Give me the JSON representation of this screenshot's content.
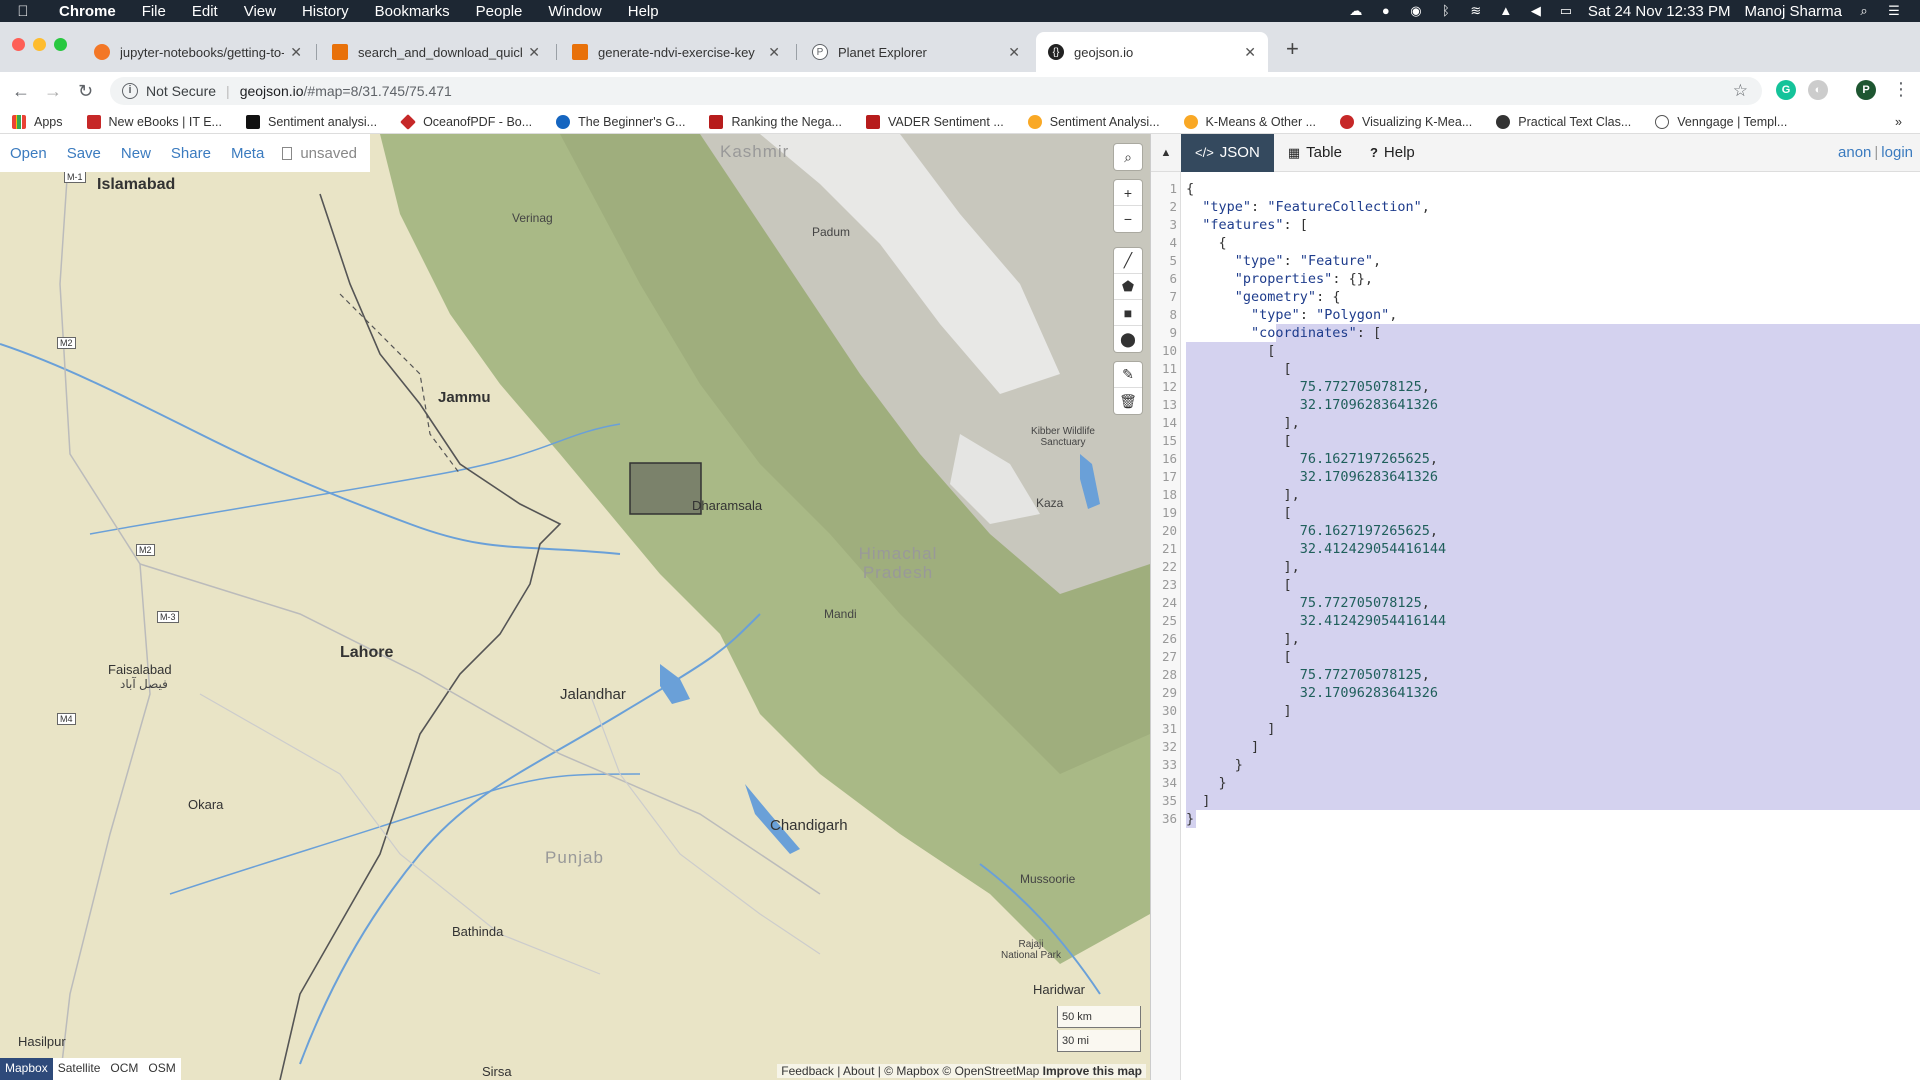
{
  "menubar": {
    "app": "Chrome",
    "items": [
      "File",
      "Edit",
      "View",
      "History",
      "Bookmarks",
      "People",
      "Window",
      "Help"
    ],
    "datetime": "Sat 24 Nov  12:33 PM",
    "user": "Manoj Sharma"
  },
  "tabs": [
    {
      "label": "jupyter-notebooks/getting-to-",
      "color": "#f37726"
    },
    {
      "label": "search_and_download_quickst",
      "color": "#e8710a"
    },
    {
      "label": "generate-ndvi-exercise-key",
      "color": "#e8710a"
    },
    {
      "label": "Planet Explorer",
      "color": "#5f6368"
    },
    {
      "label": "geojson.io",
      "color": "#222222"
    }
  ],
  "address": {
    "security": "Not Secure",
    "host": "geojson.io",
    "path": "/#map=8/31.745/75.471"
  },
  "bookmarks": [
    {
      "label": "Apps",
      "color": "#4285f4"
    },
    {
      "label": "New eBooks | IT E...",
      "color": "#c62828"
    },
    {
      "label": "Sentiment analysi...",
      "color": "#111111"
    },
    {
      "label": "OceanofPDF - Bo...",
      "color": "#c62828"
    },
    {
      "label": "The Beginner's G...",
      "color": "#1565c0"
    },
    {
      "label": "Ranking the Nega...",
      "color": "#b71c1c"
    },
    {
      "label": "VADER Sentiment ...",
      "color": "#b71c1c"
    },
    {
      "label": "Sentiment Analysi...",
      "color": "#f9a825"
    },
    {
      "label": "K-Means & Other ...",
      "color": "#f9a825"
    },
    {
      "label": "Visualizing K-Mea...",
      "color": "#c62828"
    },
    {
      "label": "Practical Text Clas...",
      "color": "#333333"
    },
    {
      "label": "Venngage | Templ...",
      "color": "#555555"
    }
  ],
  "map_toolbar": {
    "open": "Open",
    "save": "Save",
    "new": "New",
    "share": "Share",
    "meta": "Meta",
    "status": "unsaved"
  },
  "map_labels": {
    "kashmir": "Kashmir",
    "islamabad": "Islamabad",
    "verinag": "Verinag",
    "padum": "Padum",
    "jammu": "Jammu",
    "kibber": "Kibber Wildlife Sanctuary",
    "dharamsala": "Dharamsala",
    "kaza": "Kaza",
    "himachal": "Himachal Pradesh",
    "mandi": "Mandi",
    "lahore": "Lahore",
    "faisalabad": "Faisalabad",
    "faisalabad_ur": "فیصل آباد",
    "jalandhar": "Jalandhar",
    "okara": "Okara",
    "chandigarh": "Chandigarh",
    "punjab": "Punjab",
    "mussoorie": "Mussoorie",
    "bathinda": "Bathinda",
    "rajaji": "Rajaji National Park",
    "haridwar": "Haridwar",
    "hasilpur": "Hasilpur",
    "sirsa": "Sirsa",
    "m1": "M-1",
    "m2a": "M2",
    "m2b": "M2",
    "m3": "M-3",
    "m4": "M4"
  },
  "scale": {
    "km": "50 km",
    "mi": "30 mi"
  },
  "layers": [
    "Mapbox",
    "Satellite",
    "OCM",
    "OSM"
  ],
  "attribution": {
    "text": "Feedback | About | © Mapbox © OpenStreetMap",
    "improve": "Improve this map"
  },
  "panel": {
    "tabs": [
      "JSON",
      "Table",
      "Help"
    ],
    "auth_anon": "anon",
    "auth_login": "login"
  },
  "geojson_lines": [
    "{",
    "  \"type\": \"FeatureCollection\",",
    "  \"features\": [",
    "    {",
    "      \"type\": \"Feature\",",
    "      \"properties\": {},",
    "      \"geometry\": {",
    "        \"type\": \"Polygon\",",
    "        \"coordinates\": [",
    "          [",
    "            [",
    "              75.772705078125,",
    "              32.17096283641326",
    "            ],",
    "            [",
    "              76.1627197265625,",
    "              32.17096283641326",
    "            ],",
    "            [",
    "              76.1627197265625,",
    "              32.412429054416144",
    "            ],",
    "            [",
    "              75.772705078125,",
    "              32.412429054416144",
    "            ],",
    "            [",
    "              75.772705078125,",
    "              32.17096283641326",
    "            ]",
    "          ]",
    "        ]",
    "      }",
    "    }",
    "  ]",
    "}"
  ]
}
